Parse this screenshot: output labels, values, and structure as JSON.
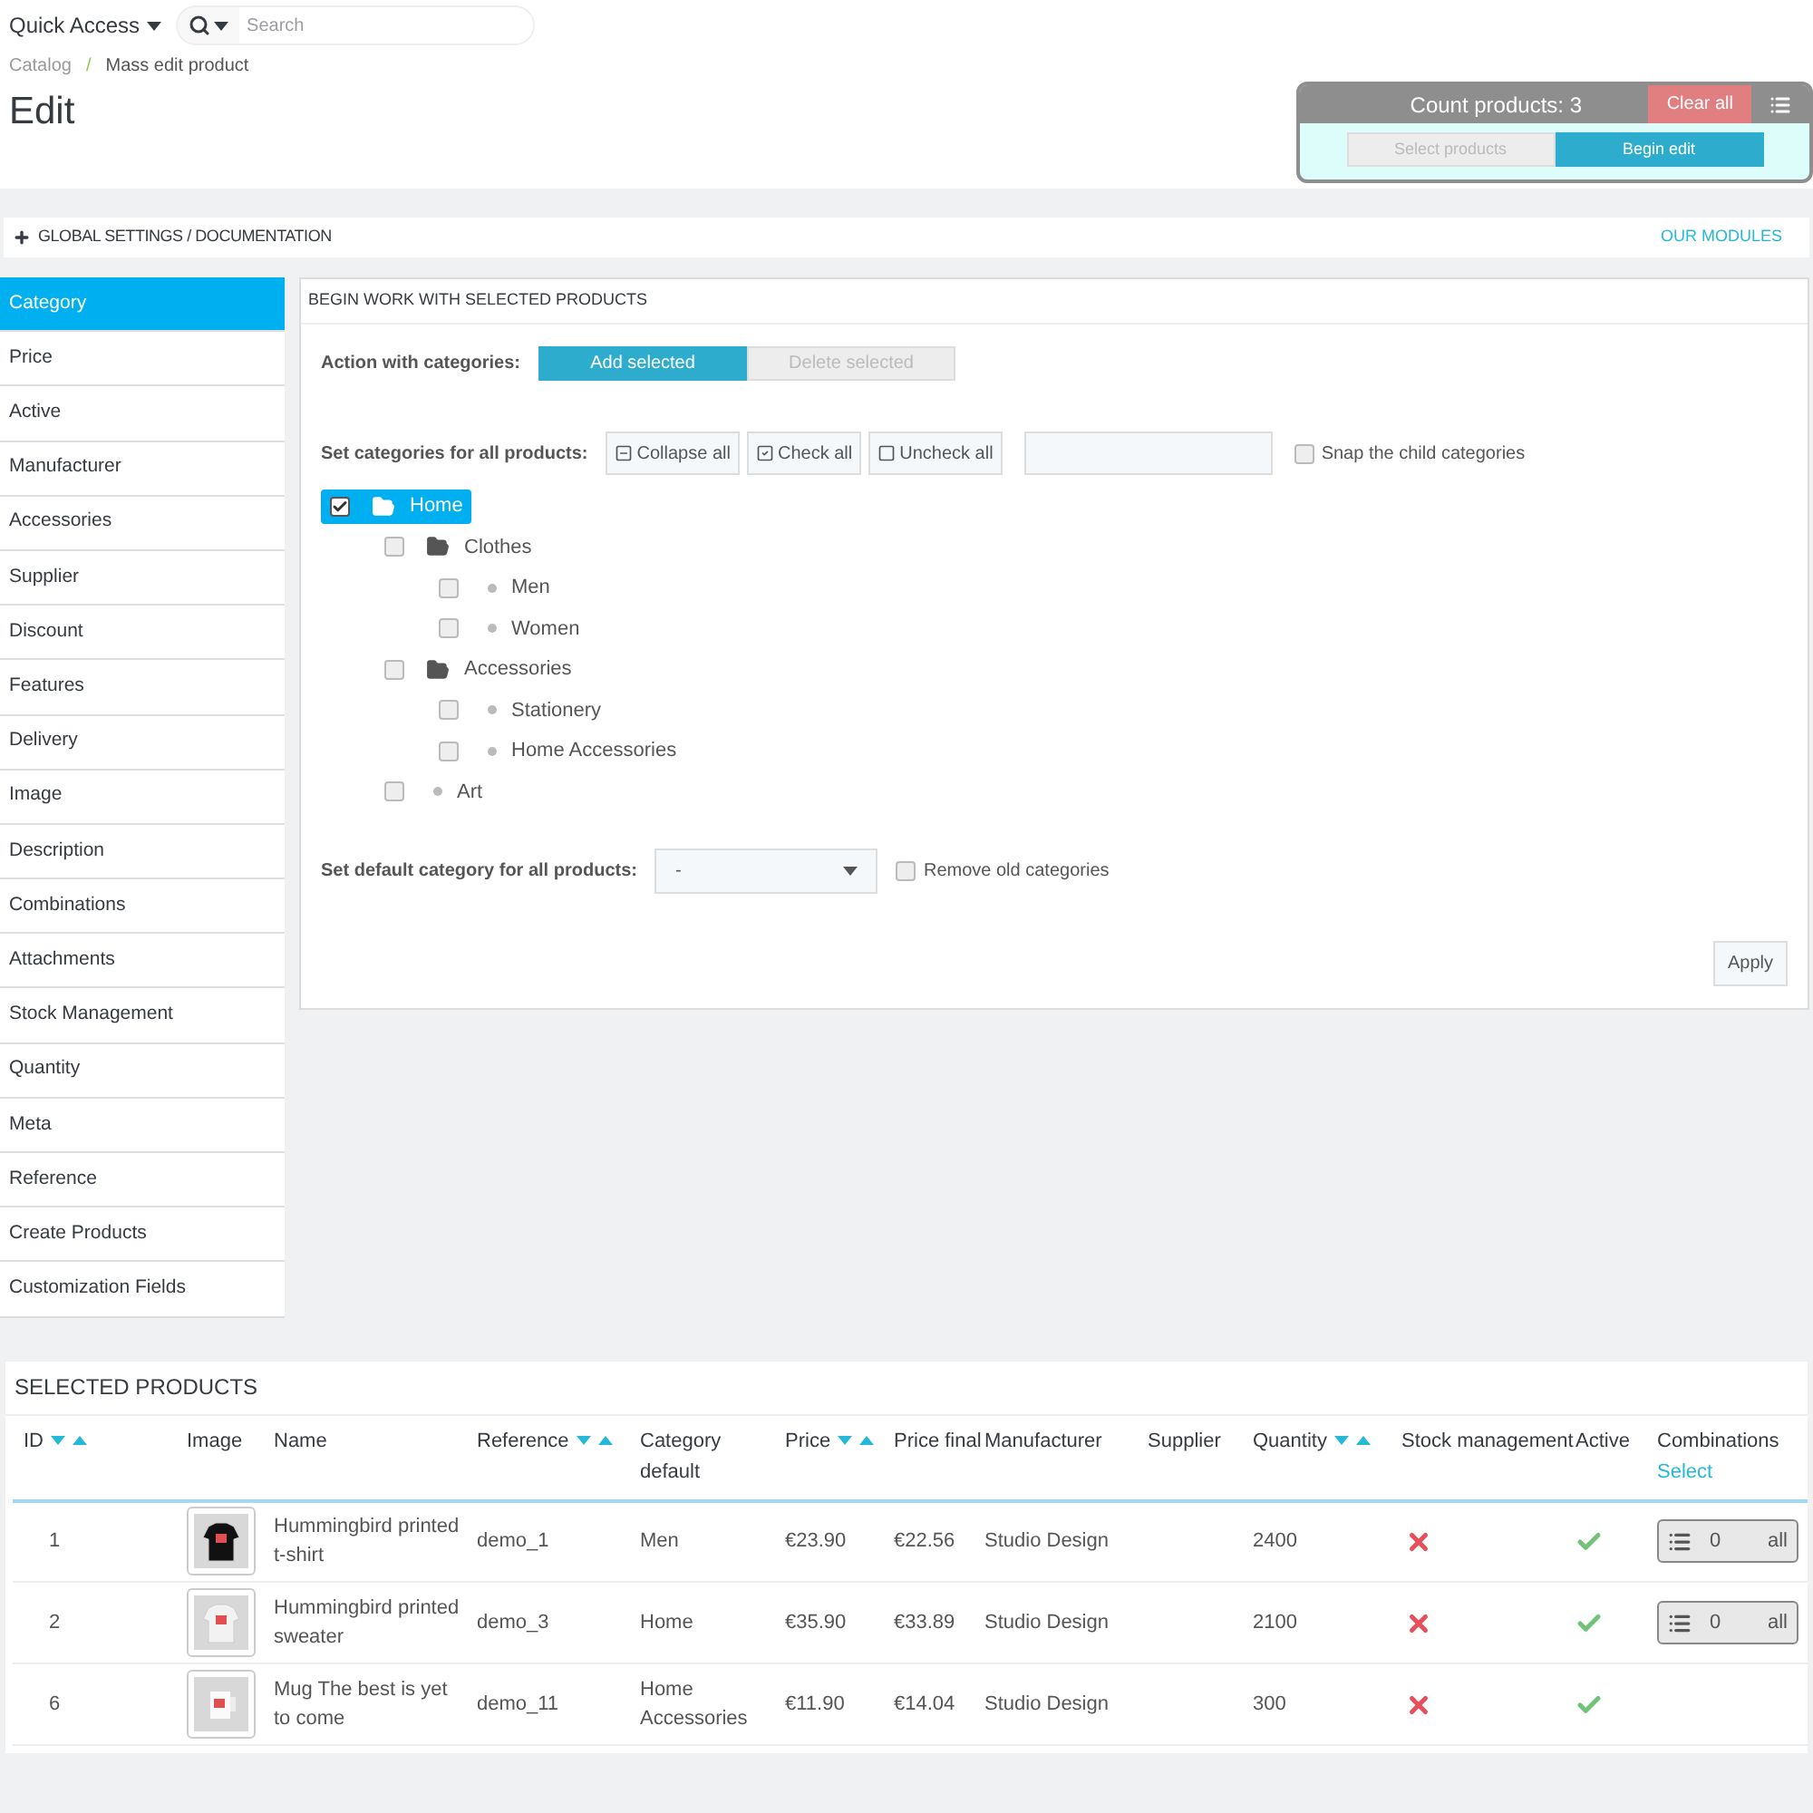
{
  "header": {
    "quick_access": "Quick Access",
    "search_placeholder": "Search"
  },
  "breadcrumb": {
    "separator": "/",
    "items": [
      "Catalog",
      "Mass edit product"
    ]
  },
  "page_title": "Edit",
  "count_panel": {
    "count": "Count products: 3",
    "clear": "Clear all",
    "buttons": [
      {
        "label": "Select products",
        "selected": false
      },
      {
        "label": "Begin edit",
        "selected": true
      }
    ]
  },
  "settings_bar": {
    "title": "GLOBAL SETTINGS / DOCUMENTATION",
    "link": "OUR MODULES"
  },
  "sidebar": {
    "items": [
      {
        "label": "Category",
        "selected": true
      },
      {
        "label": "Price",
        "selected": false
      },
      {
        "label": "Active",
        "selected": false
      },
      {
        "label": "Manufacturer",
        "selected": false
      },
      {
        "label": "Accessories",
        "selected": false
      },
      {
        "label": "Supplier",
        "selected": false
      },
      {
        "label": "Discount",
        "selected": false
      },
      {
        "label": "Features",
        "selected": false
      },
      {
        "label": "Delivery",
        "selected": false
      },
      {
        "label": "Image",
        "selected": false
      },
      {
        "label": "Description",
        "selected": false
      },
      {
        "label": "Combinations",
        "selected": false
      },
      {
        "label": "Attachments",
        "selected": false
      },
      {
        "label": "Stock Management",
        "selected": false
      },
      {
        "label": "Quantity",
        "selected": false
      },
      {
        "label": "Meta",
        "selected": false
      },
      {
        "label": "Reference",
        "selected": false
      },
      {
        "label": "Create Products",
        "selected": false
      },
      {
        "label": "Customization Fields",
        "selected": false
      }
    ]
  },
  "panel": {
    "title": "BEGIN WORK WITH SELECTED PRODUCTS",
    "action_label": "Action with categories:",
    "action_buttons": [
      {
        "label": "Add selected",
        "selected": true
      },
      {
        "label": "Delete selected",
        "selected": false
      }
    ],
    "set_label": "Set categories for all products:",
    "tree_buttons": [
      {
        "label": "Collapse all",
        "kind": "collapse"
      },
      {
        "label": "Check all",
        "kind": "check"
      },
      {
        "label": "Uncheck all",
        "kind": "uncheck"
      }
    ],
    "snap": {
      "label": "Snap the child categories",
      "checked": false
    },
    "tree": [
      {
        "label": "Home",
        "kind": "folder",
        "checked": true,
        "selected": true,
        "children": [
          {
            "label": "Clothes",
            "kind": "folder",
            "checked": false,
            "selected": false,
            "children": [
              {
                "label": "Men",
                "kind": "leaf",
                "checked": false,
                "selected": false
              },
              {
                "label": "Women",
                "kind": "leaf",
                "checked": false,
                "selected": false
              }
            ]
          },
          {
            "label": "Accessories",
            "kind": "folder",
            "checked": false,
            "selected": false,
            "children": [
              {
                "label": "Stationery",
                "kind": "leaf",
                "checked": false,
                "selected": false
              },
              {
                "label": "Home Accessories",
                "kind": "leaf",
                "checked": false,
                "selected": false
              }
            ]
          },
          {
            "label": "Art",
            "kind": "leaf",
            "checked": false,
            "selected": false
          }
        ]
      }
    ],
    "default_label": "Set default category for all products:",
    "default_value": "-",
    "remove_old": {
      "label": "Remove old categories",
      "checked": false
    },
    "apply": "Apply"
  },
  "products": {
    "title": "SELECTED PRODUCTS",
    "columns": [
      {
        "label": "ID",
        "sortable": true
      },
      {
        "label": "Image",
        "sortable": false
      },
      {
        "label": "Name",
        "sortable": false
      },
      {
        "label": "Reference",
        "sortable": true
      },
      {
        "label": "Category default",
        "sortable": false
      },
      {
        "label": "Price",
        "sortable": true
      },
      {
        "label": "Price final",
        "sortable": false
      },
      {
        "label": "Manufacturer",
        "sortable": false
      },
      {
        "label": "Supplier",
        "sortable": false
      },
      {
        "label": "Quantity",
        "sortable": true
      },
      {
        "label": "Stock management",
        "sortable": false
      },
      {
        "label": "Active",
        "sortable": false
      },
      {
        "label": "Combinations",
        "sortable": false,
        "link": "Select"
      }
    ],
    "rows": [
      {
        "id": "1",
        "name": "Hummingbird printed t-shirt",
        "reference": "demo_1",
        "category": "Men",
        "price": "€23.90",
        "price_final": "€22.56",
        "manufacturer": "Studio Design",
        "quantity": "2400",
        "stock_management": false,
        "active": true,
        "combinations": {
          "count": "0",
          "label": "all"
        }
      },
      {
        "id": "2",
        "name": "Hummingbird printed sweater",
        "reference": "demo_3",
        "category": "Home",
        "price": "€35.90",
        "price_final": "€33.89",
        "manufacturer": "Studio Design",
        "quantity": "2100",
        "stock_management": false,
        "active": true,
        "combinations": {
          "count": "0",
          "label": "all"
        }
      },
      {
        "id": "6",
        "name": "Mug The best is yet to come",
        "reference": "demo_11",
        "category": "Home Accessories",
        "price": "€11.90",
        "price_final": "€14.04",
        "manufacturer": "Studio Design",
        "quantity": "300",
        "stock_management": false,
        "active": true
      }
    ]
  }
}
